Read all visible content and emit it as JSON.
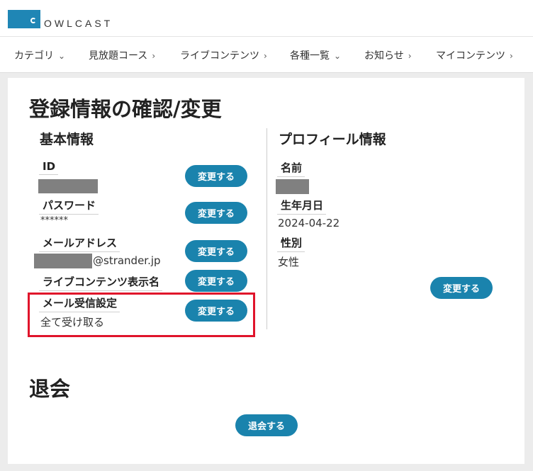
{
  "logo": {
    "text": "OWLCAST"
  },
  "nav": [
    {
      "label": "カテゴリ",
      "icon": "chevron-down-icon",
      "glyph": "⌄"
    },
    {
      "label": "見放題コース",
      "icon": "chevron-right-icon",
      "glyph": "›"
    },
    {
      "label": "ライブコンテンツ",
      "icon": "chevron-right-icon",
      "glyph": "›"
    },
    {
      "label": "各種一覧",
      "icon": "chevron-down-icon",
      "glyph": "⌄"
    },
    {
      "label": "お知らせ",
      "icon": "chevron-right-icon",
      "glyph": "›"
    },
    {
      "label": "マイコンテンツ",
      "icon": "chevron-right-icon",
      "glyph": "›"
    }
  ],
  "page_title": "登録情報の確認/変更",
  "basic": {
    "title": "基本情報",
    "id": {
      "label": "ID"
    },
    "password": {
      "label": "パスワード",
      "value": "******"
    },
    "email": {
      "label": "メールアドレス",
      "value_suffix": "@strander.jp"
    },
    "display_name": {
      "label": "ライブコンテンツ表示名"
    },
    "mail_setting": {
      "label": "メール受信設定",
      "value": "全て受け取る"
    },
    "change_label": "変更する"
  },
  "profile": {
    "title": "プロフィール情報",
    "name": {
      "label": "名前"
    },
    "birthday": {
      "label": "生年月日",
      "value": "2024-04-22"
    },
    "gender": {
      "label": "性別",
      "value": "女性"
    },
    "change_label": "変更する"
  },
  "withdraw": {
    "title": "退会",
    "button_label": "退会する"
  },
  "colors": {
    "accent": "#1a83ad",
    "highlight": "#e0142b",
    "logo": "#1f86b5"
  }
}
